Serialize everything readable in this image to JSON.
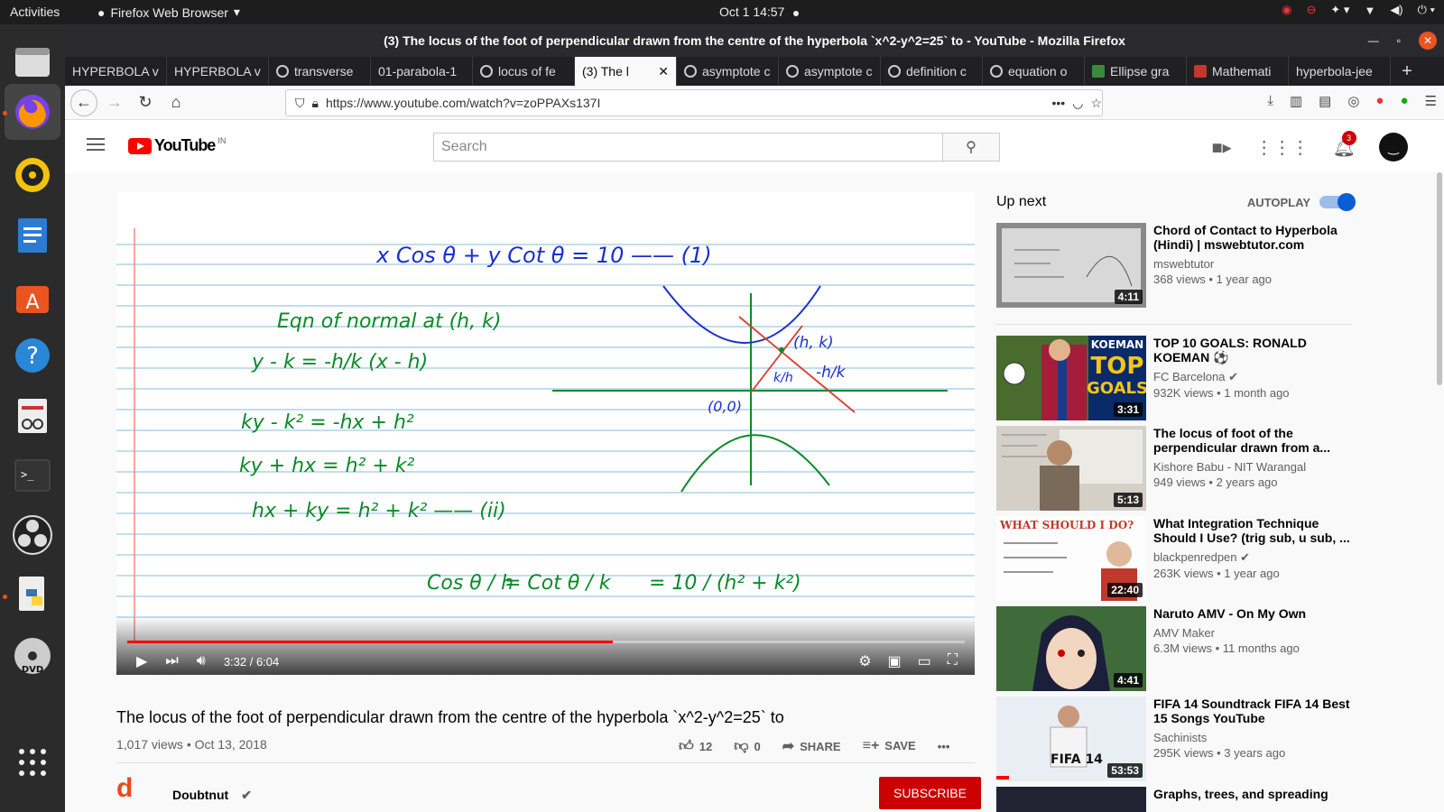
{
  "gnome": {
    "activities": "Activities",
    "app_name": "Firefox Web Browser",
    "clock": "Oct 1  14:57"
  },
  "window": {
    "title": "(3) The locus of the foot of perpendicular drawn from the centre of the hyperbola `x^2-y^2=25` to - YouTube - Mozilla Firefox"
  },
  "tabs": [
    {
      "label": "HYPERBOLA v",
      "icon": "none"
    },
    {
      "label": "HYPERBOLA v",
      "icon": "none"
    },
    {
      "label": "transverse",
      "icon": "google"
    },
    {
      "label": "01-parabola-1",
      "icon": "none"
    },
    {
      "label": "locus of fe",
      "icon": "google"
    },
    {
      "label": "(3) The l",
      "icon": "youtube",
      "active": true
    },
    {
      "label": "asymptote c",
      "icon": "google"
    },
    {
      "label": "asymptote c",
      "icon": "google"
    },
    {
      "label": "definition c",
      "icon": "google"
    },
    {
      "label": "equation o",
      "icon": "google"
    },
    {
      "label": "Ellipse gra",
      "icon": "graph"
    },
    {
      "label": "Mathemati",
      "icon": "math"
    },
    {
      "label": "hyperbola-jee",
      "icon": "none"
    }
  ],
  "url": "https://www.youtube.com/watch?v=zoPPAXs137I",
  "youtube": {
    "logo_text": "YouTube",
    "region": "IN",
    "search_placeholder": "Search",
    "notifications": "3",
    "video": {
      "time": "3:32 / 6:04",
      "progress": 0.58,
      "title": "The locus of the foot of perpendicular drawn from the centre of the hyperbola `x^2-y^2=25` to",
      "meta": "1,017 views • Oct 13, 2018",
      "likes": "12",
      "dislikes": "0",
      "share": "SHARE",
      "save": "SAVE",
      "channel": "Doubtnut",
      "subscribe": "SUBSCRIBE"
    },
    "board": {
      "line1": "x Cos θ  +  y Cot θ  =  10 —— (1)",
      "line2": "Eqn of   normal at (h, k)",
      "line3": "y - k = -h/k (x - h)",
      "line4": "ky - k² = -hx + h²",
      "line5": "ky + hx = h² + k²",
      "line6": "hx + ky = h² + k² —— (ii)",
      "line7a": "Cos θ / h",
      "line7b": "= Cot θ / k",
      "line7c": "= 10 / (h² + k²)",
      "label_hk": "(h, k)",
      "label_kh": "k/h",
      "label_mhk": "-h/k",
      "label_origin": "(0,0)"
    },
    "upnext_label": "Up next",
    "autoplay_label": "AUTOPLAY",
    "recommendations": [
      {
        "title": "Chord of Contact to Hyperbola (Hindi) | mswebtutor.com",
        "channel": "mswebtutor",
        "views": "368 views • 1 year ago",
        "duration": "4:11"
      },
      {
        "title": "TOP 10 GOALS: RONALD KOEMAN ⚽",
        "channel": "FC Barcelona ✔",
        "views": "932K views • 1 month ago",
        "duration": "3:31"
      },
      {
        "title": "The locus of foot of the perpendicular drawn from a...",
        "channel": "Kishore Babu - NIT Warangal",
        "views": "949 views • 2 years ago",
        "duration": "5:13"
      },
      {
        "title": "What Integration Technique Should I Use? (trig sub, u sub, ...",
        "channel": "blackpenredpen ✔",
        "views": "263K views • 1 year ago",
        "duration": "22:40"
      },
      {
        "title": "Naruto AMV - On My Own",
        "channel": "AMV Maker",
        "views": "6.3M views • 11 months ago",
        "duration": "4:41"
      },
      {
        "title": "FIFA 14 Soundtrack FIFA 14 Best 15 Songs YouTube",
        "channel": "Sachinists",
        "views": "295K views • 3 years ago",
        "duration": "53:53"
      },
      {
        "title": "Graphs, trees, and spreading",
        "channel": "",
        "views": "",
        "duration": ""
      }
    ],
    "thumb_text": {
      "koeman": "KOEMAN",
      "top": "TOP",
      "goals": "GOALS",
      "what": "WHAT SHOULD I DO?",
      "fifa": "FIFA 14"
    }
  },
  "colors": {
    "accent_red": "#ff0000",
    "ubuntu_orange": "#e95420",
    "ink_green": "#0a8a2a",
    "ink_blue": "#1a2fd0",
    "ink_red": "#e03a2a"
  }
}
